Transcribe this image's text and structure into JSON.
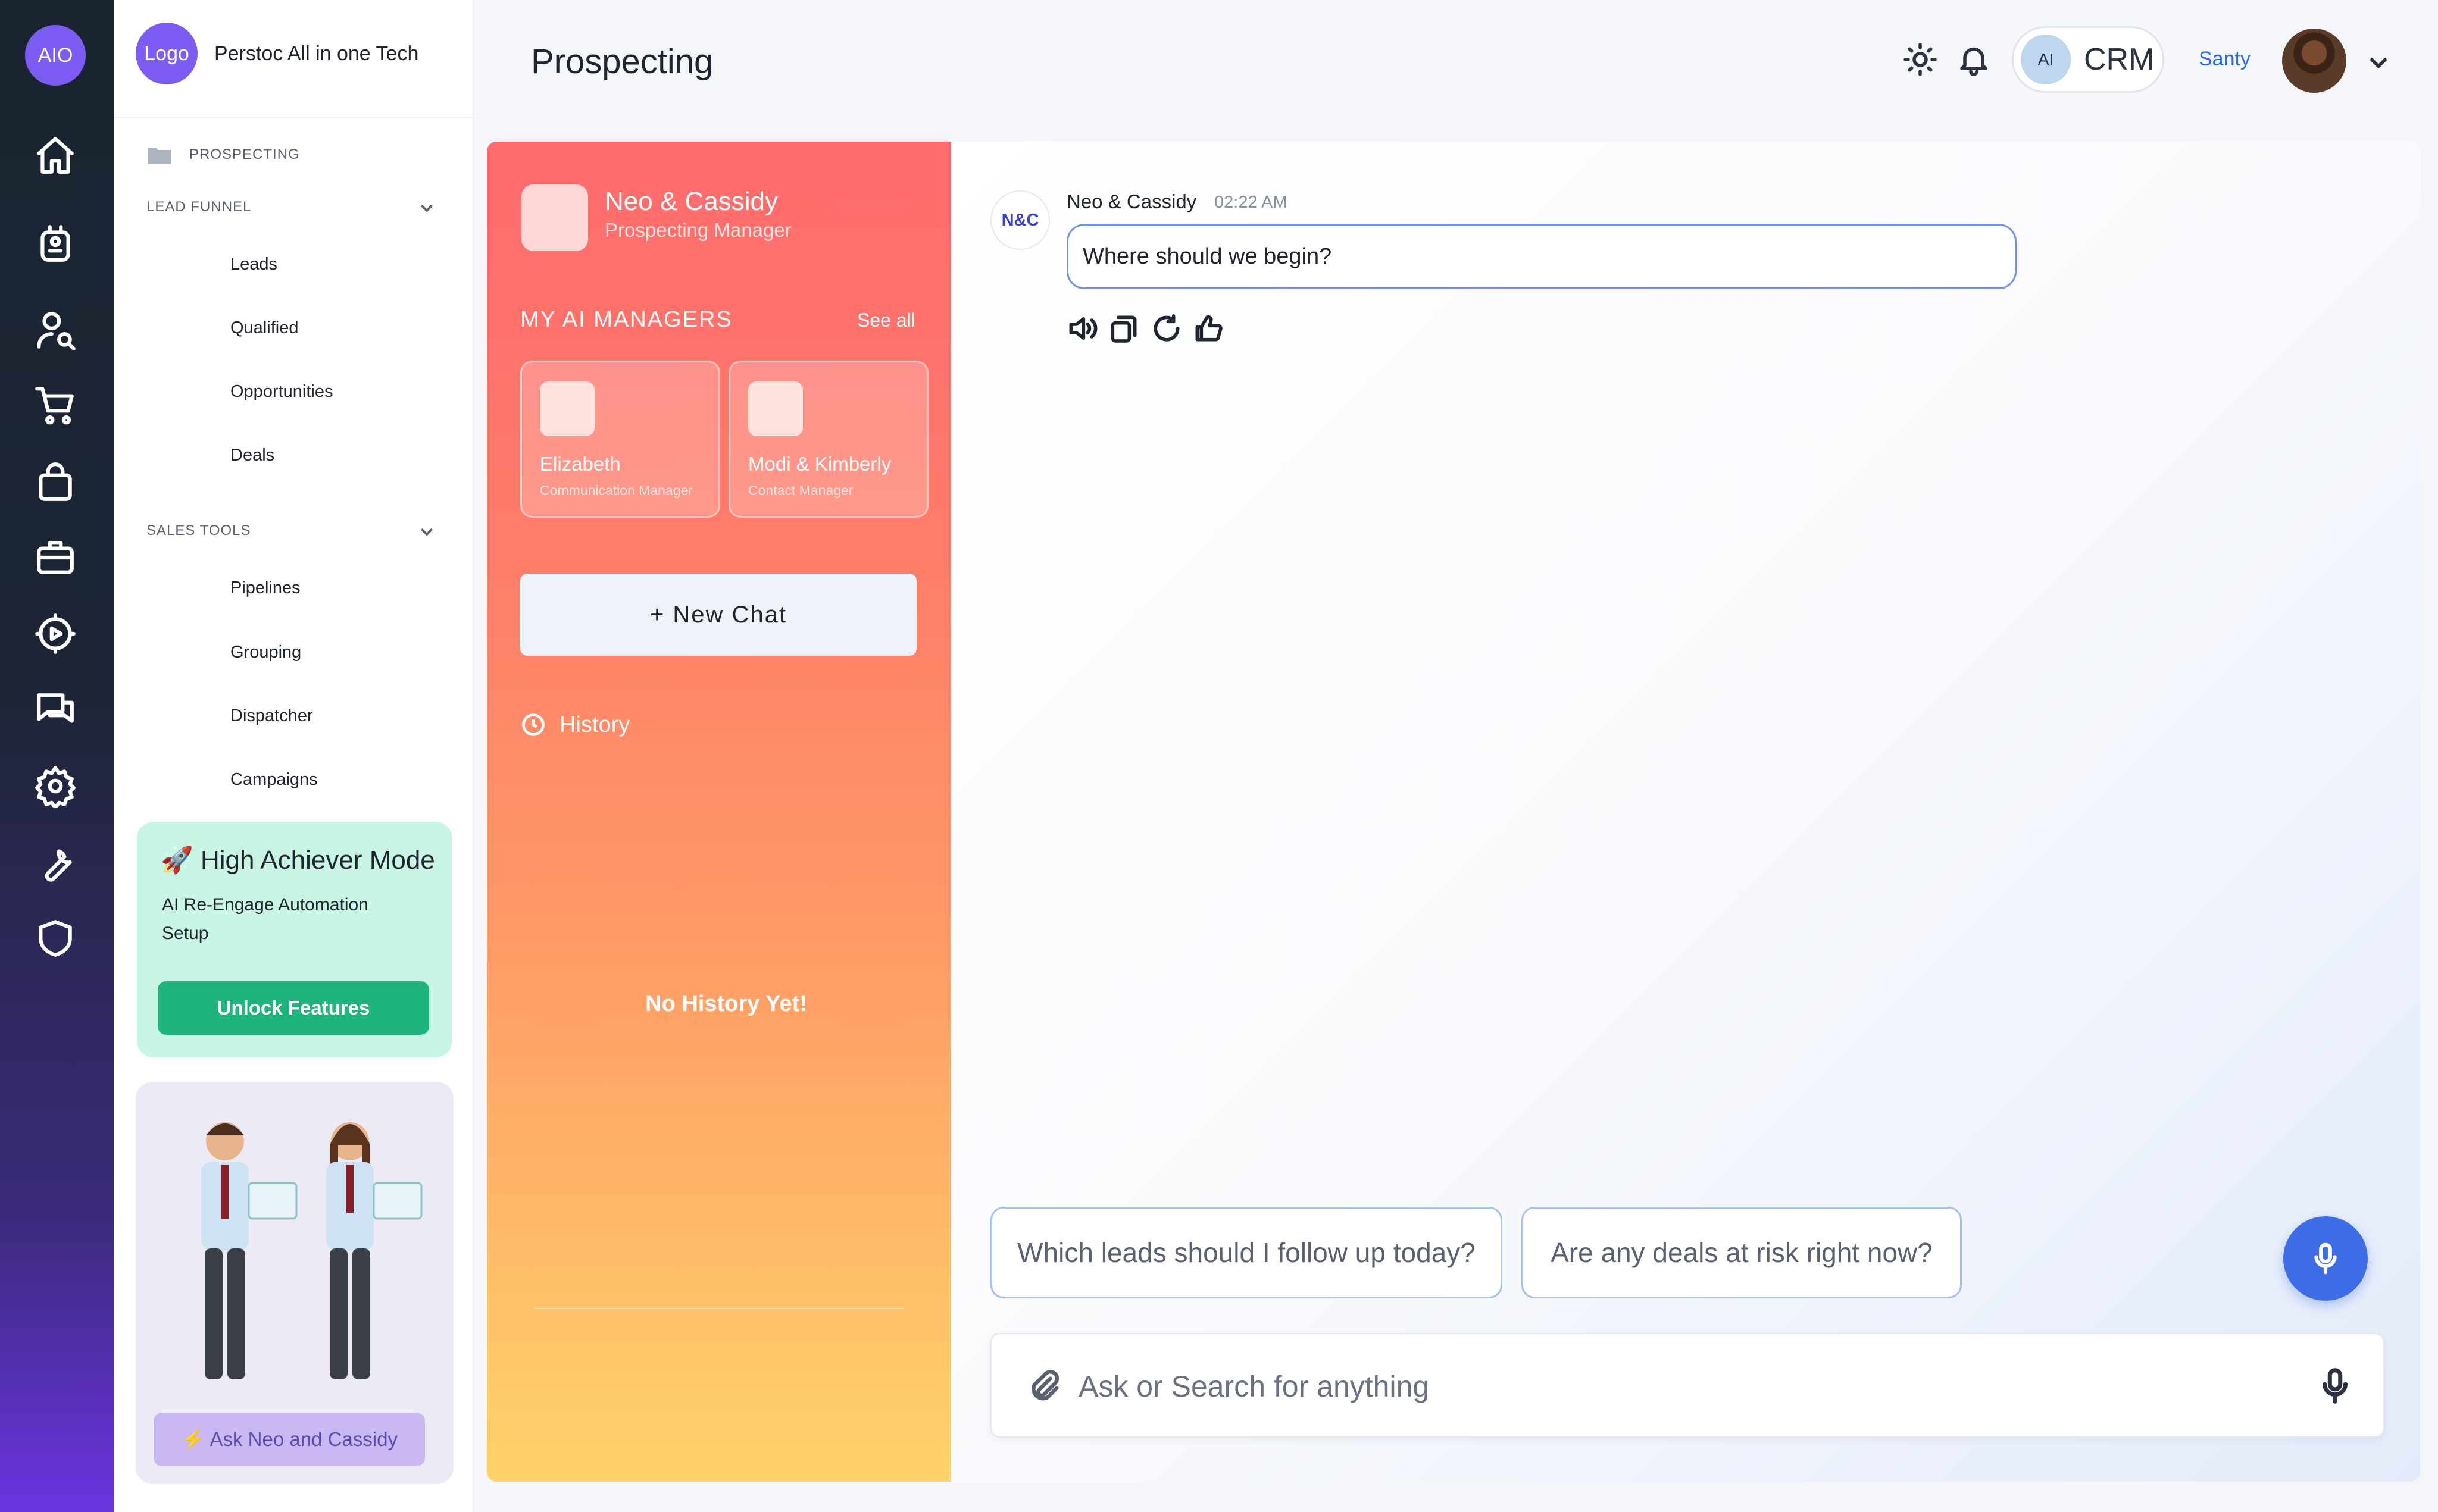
{
  "rail": {
    "logo": "AIO",
    "icons": [
      "home-icon",
      "robot-icon",
      "user-search-icon",
      "cart-icon",
      "shopping-bag-icon",
      "briefcase-icon",
      "play-settings-icon",
      "chat-icon",
      "gear-icon",
      "wrench-icon",
      "shield-icon"
    ]
  },
  "brand": {
    "logo": "Logo",
    "name": "Perstoc All in one Tech"
  },
  "nav": {
    "prospecting": "PROSPECTING",
    "lead_funnel": "LEAD FUNNEL",
    "lead_items": [
      "Leads",
      "Qualified",
      "Opportunities",
      "Deals"
    ],
    "sales_tools": "SALES TOOLS",
    "sales_items": [
      "Pipelines",
      "Grouping",
      "Dispatcher",
      "Campaigns"
    ]
  },
  "achiever": {
    "title": "🚀 High Achiever Mode",
    "desc": "AI Re-Engage Automation Setup",
    "button": "Unlock Features"
  },
  "promo": {
    "button": "⚡ Ask Neo and Cassidy"
  },
  "header": {
    "title": "Prospecting",
    "crm_ai": "AI",
    "crm_label": "CRM",
    "user": "Santy"
  },
  "managers": {
    "current_name": "Neo & Cassidy",
    "current_role": "Prospecting Manager",
    "section": "MY AI MANAGERS",
    "see_all": "See all",
    "cards": [
      {
        "name": "Elizabeth",
        "role": "Communication Manager"
      },
      {
        "name": "Modi & Kimberly",
        "role": "Contact Manager"
      }
    ],
    "new_chat": "+ New Chat",
    "history": "History",
    "no_history": "No History Yet!"
  },
  "chat": {
    "badge": "N&C",
    "sender": "Neo & Cassidy",
    "time": "02:22 AM",
    "message": "Where should we begin?",
    "suggestions": [
      "Which leads should I follow up today?",
      "Are any deals at risk right now?"
    ],
    "input_placeholder": "Ask or Search for anything"
  },
  "colors": {
    "accent": "#3c6ce6",
    "brand_purple": "#7c5cf3",
    "success": "#1fb37d",
    "manager_gradient_top": "#ff6b6e",
    "manager_gradient_bottom": "#ffd36a"
  }
}
